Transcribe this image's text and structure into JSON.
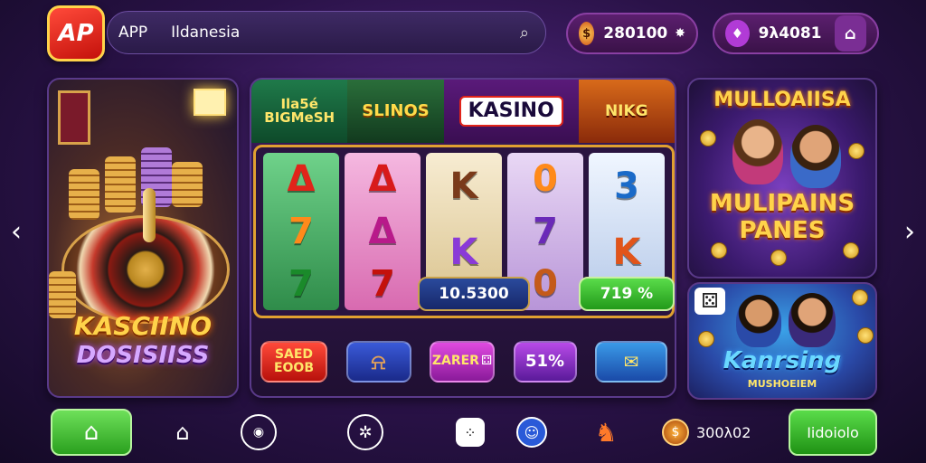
{
  "header": {
    "logo_text": "AP",
    "app_label": "APP",
    "search_value": "Ildanesia",
    "coins": "280100",
    "gems": "9λ4081"
  },
  "left_banner": {
    "title_line1": "KASCIINO",
    "title_line2": "DOSISIISS"
  },
  "games_strip": [
    {
      "label": "Ila5é BIGMeSH"
    },
    {
      "label": "SLINOS"
    },
    {
      "label": "KASINO"
    },
    {
      "label": "NIKG"
    }
  ],
  "reels": [
    [
      "Δ",
      "7",
      "7"
    ],
    [
      "Δ",
      "Δ",
      "7"
    ],
    [
      "K",
      "K",
      ""
    ],
    [
      "0",
      "7",
      "0"
    ],
    [
      "3",
      "K",
      ""
    ]
  ],
  "bet_value": "10.5300",
  "win_percent": "719 %",
  "controls": [
    {
      "label": "SAED EOOB"
    },
    {
      "label": ""
    },
    {
      "label": "ZARER"
    },
    {
      "label": "51%"
    },
    {
      "label": ""
    }
  ],
  "right_top": {
    "title": "MULLOAIISA",
    "subtitle_line1": "MULIPAINS",
    "subtitle_line2": "PANES"
  },
  "right_bottom": {
    "title": "Kanrsing",
    "subtitle": "MUSHOEIEM"
  },
  "bottom_nav": {
    "balance": "300λ02",
    "cta_label": "Iidoiolo"
  },
  "colors": {
    "accent_gold": "#ffd34a",
    "brand_red": "#e1241a",
    "success_green": "#2aa01e"
  }
}
